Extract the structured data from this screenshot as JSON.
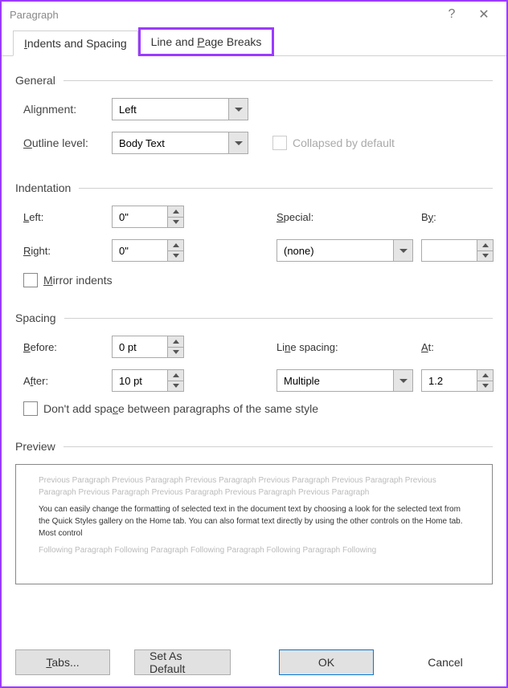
{
  "title": "Paragraph",
  "tabs": {
    "indents": "Indents and Spacing",
    "breaks": "Line and Page Breaks"
  },
  "section": {
    "general": "General",
    "indentation": "Indentation",
    "spacing": "Spacing",
    "preview": "Preview"
  },
  "general": {
    "alignment_label": "Alignment:",
    "alignment_value": "Left",
    "outline_label": "Outline level:",
    "outline_value": "Body Text",
    "collapsed_label": "Collapsed by default"
  },
  "indentation": {
    "left_label": "Left:",
    "left_value": "0\"",
    "right_label": "Right:",
    "right_value": "0\"",
    "special_label": "Special:",
    "special_value": "(none)",
    "by_label": "By:",
    "by_value": "",
    "mirror_label": "Mirror indents"
  },
  "spacing": {
    "before_label": "Before:",
    "before_value": "0 pt",
    "after_label": "After:",
    "after_value": "10 pt",
    "line_label": "Line spacing:",
    "line_value": "Multiple",
    "at_label": "At:",
    "at_value": "1.2",
    "noadd_label": "Don't add space between paragraphs of the same style"
  },
  "preview": {
    "prev": "Previous Paragraph Previous Paragraph Previous Paragraph Previous Paragraph Previous Paragraph Previous Paragraph Previous Paragraph Previous Paragraph Previous Paragraph Previous Paragraph",
    "sample": "You can easily change the formatting of selected text in the document text by choosing a look for the selected text from the Quick Styles gallery on the Home tab. You can also format text directly by using the other controls on the Home tab. Most control",
    "next": "Following Paragraph Following Paragraph Following Paragraph Following Paragraph Following"
  },
  "buttons": {
    "tabs": "Tabs...",
    "default": "Set As Default",
    "ok": "OK",
    "cancel": "Cancel"
  }
}
